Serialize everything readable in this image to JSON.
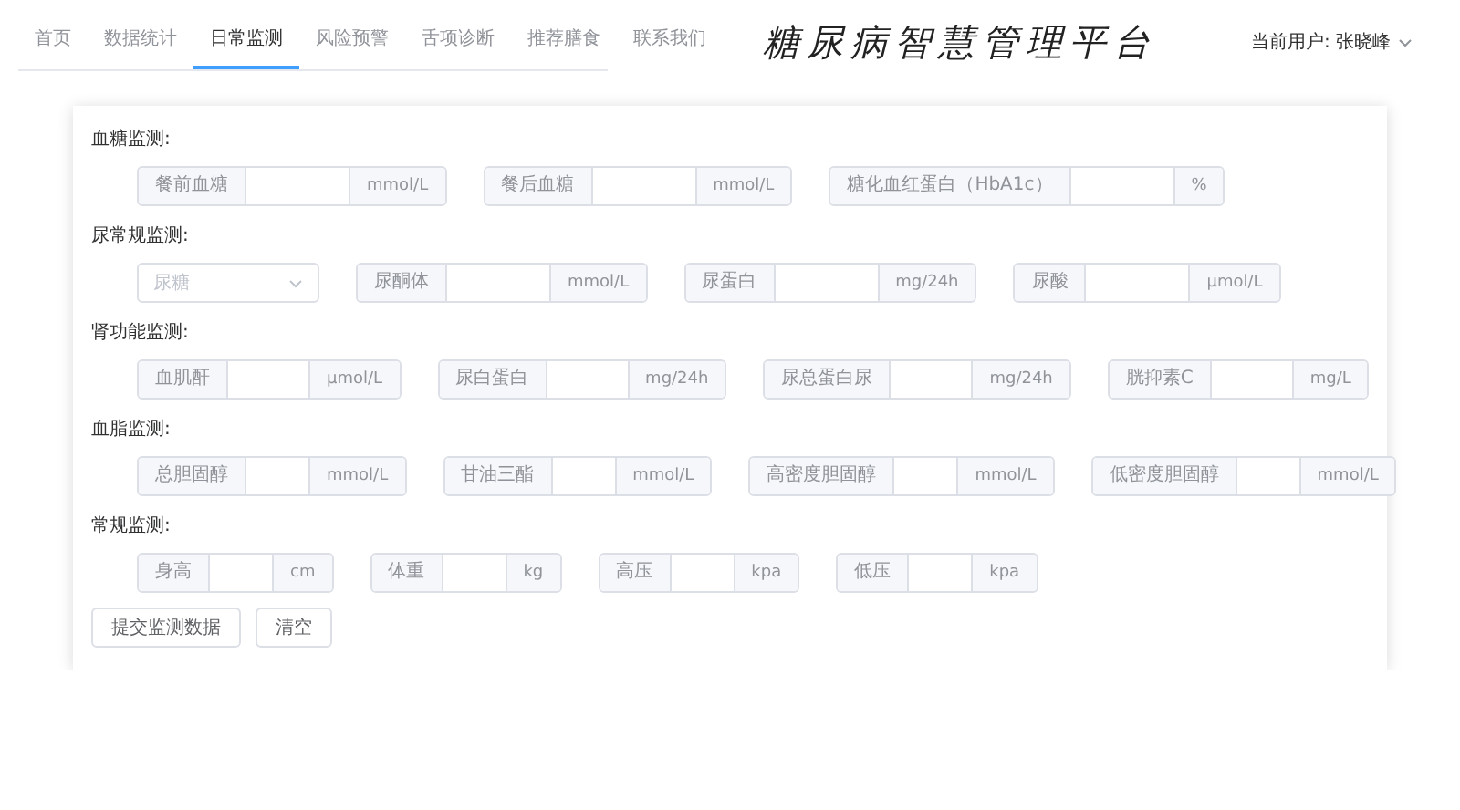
{
  "nav": {
    "tabs": [
      {
        "label": "首页",
        "selected": false
      },
      {
        "label": "数据统计",
        "selected": false
      },
      {
        "label": "日常监测",
        "selected": true
      },
      {
        "label": "风险预警",
        "selected": false
      },
      {
        "label": "舌项诊断",
        "selected": false
      },
      {
        "label": "推荐膳食",
        "selected": false
      },
      {
        "label": "联系我们",
        "selected": false
      }
    ]
  },
  "title": "糖尿病智慧管理平台",
  "user": {
    "text": "当前用户: 张晓峰"
  },
  "sections": [
    {
      "title": "血糖监测:",
      "fields": [
        {
          "kind": "input",
          "label": "餐前血糖",
          "unit": "mmol/L"
        },
        {
          "kind": "input",
          "label": "餐后血糖",
          "unit": "mmol/L"
        },
        {
          "kind": "input",
          "label": "糖化血红蛋白（HbA1c）",
          "unit": "%"
        }
      ]
    },
    {
      "title": "尿常规监测:",
      "fields": [
        {
          "kind": "select",
          "placeholder": "尿糖"
        },
        {
          "kind": "input",
          "label": "尿酮体",
          "unit": "mmol/L"
        },
        {
          "kind": "input",
          "label": "尿蛋白",
          "unit": "mg/24h"
        },
        {
          "kind": "input",
          "label": "尿酸",
          "unit": "μmol/L"
        }
      ]
    },
    {
      "title": "肾功能监测:",
      "fields": [
        {
          "kind": "input",
          "label": "血肌酐",
          "unit": "μmol/L"
        },
        {
          "kind": "input",
          "label": "尿白蛋白",
          "unit": "mg/24h"
        },
        {
          "kind": "input",
          "label": "尿总蛋白尿",
          "unit": "mg/24h"
        },
        {
          "kind": "input",
          "label": "胱抑素C",
          "unit": "mg/L"
        }
      ]
    },
    {
      "title": "血脂监测:",
      "fields": [
        {
          "kind": "input",
          "label": "总胆固醇",
          "unit": "mmol/L"
        },
        {
          "kind": "input",
          "label": "甘油三酯",
          "unit": "mmol/L"
        },
        {
          "kind": "input",
          "label": "高密度胆固醇",
          "unit": "mmol/L"
        },
        {
          "kind": "input",
          "label": "低密度胆固醇",
          "unit": "mmol/L"
        }
      ]
    },
    {
      "title": "常规监测:",
      "fields": [
        {
          "kind": "input",
          "label": "身高",
          "unit": "cm"
        },
        {
          "kind": "input",
          "label": "体重",
          "unit": "kg"
        },
        {
          "kind": "input",
          "label": "高压",
          "unit": "kpa"
        },
        {
          "kind": "input",
          "label": "低压",
          "unit": "kpa"
        }
      ]
    }
  ],
  "buttons": [
    "提交监测数据",
    "清空"
  ]
}
